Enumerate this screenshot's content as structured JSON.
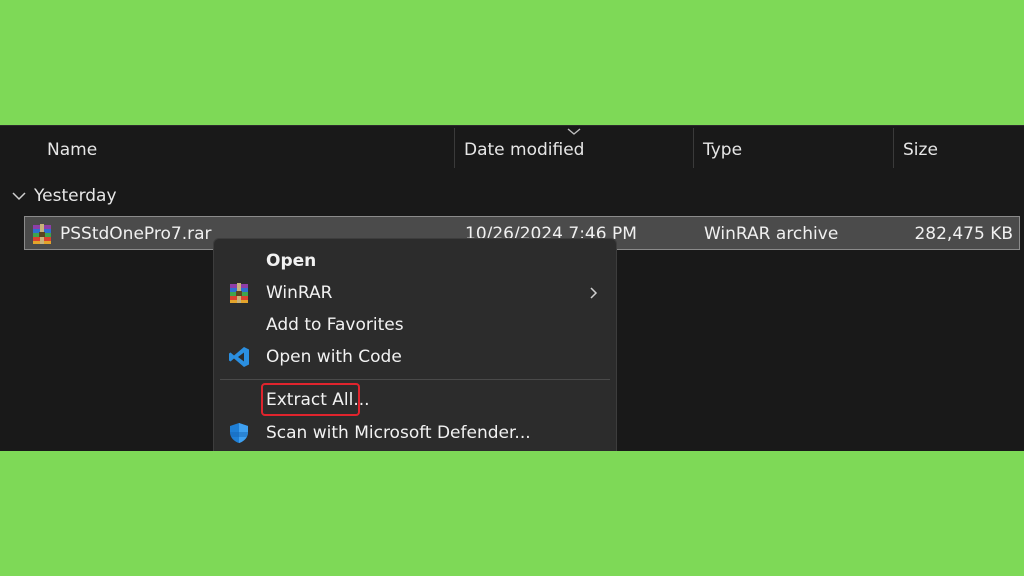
{
  "explorer": {
    "columns": [
      {
        "key": "name",
        "label": "Name"
      },
      {
        "key": "date",
        "label": "Date modified"
      },
      {
        "key": "type",
        "label": "Type"
      },
      {
        "key": "size",
        "label": "Size"
      }
    ],
    "group": {
      "label": "Yesterday"
    },
    "file": {
      "name": "PSStdOnePro7.rar",
      "date": "10/26/2024 7:46 PM",
      "type": "WinRAR archive",
      "size": "282,475 KB",
      "icon": "winrar-archive-icon"
    }
  },
  "context_menu": {
    "items": [
      {
        "label": "Open",
        "icon": ""
      },
      {
        "label": "WinRAR",
        "icon": "winrar-icon",
        "has_submenu": true
      },
      {
        "label": "Add to Favorites",
        "icon": ""
      },
      {
        "label": "Open with Code",
        "icon": "vscode-icon"
      },
      {
        "label": "Extract All...",
        "icon": "",
        "highlighted": true
      },
      {
        "label": "Scan with Microsoft Defender...",
        "icon": "defender-shield-icon"
      }
    ]
  },
  "colors": {
    "page_background": "#7ed957",
    "explorer_background": "#191919",
    "selected_row": "#4b4b4b",
    "menu_background": "#2c2c2c",
    "highlight_border": "#e0242d",
    "vscode_blue": "#2b8fe0"
  }
}
